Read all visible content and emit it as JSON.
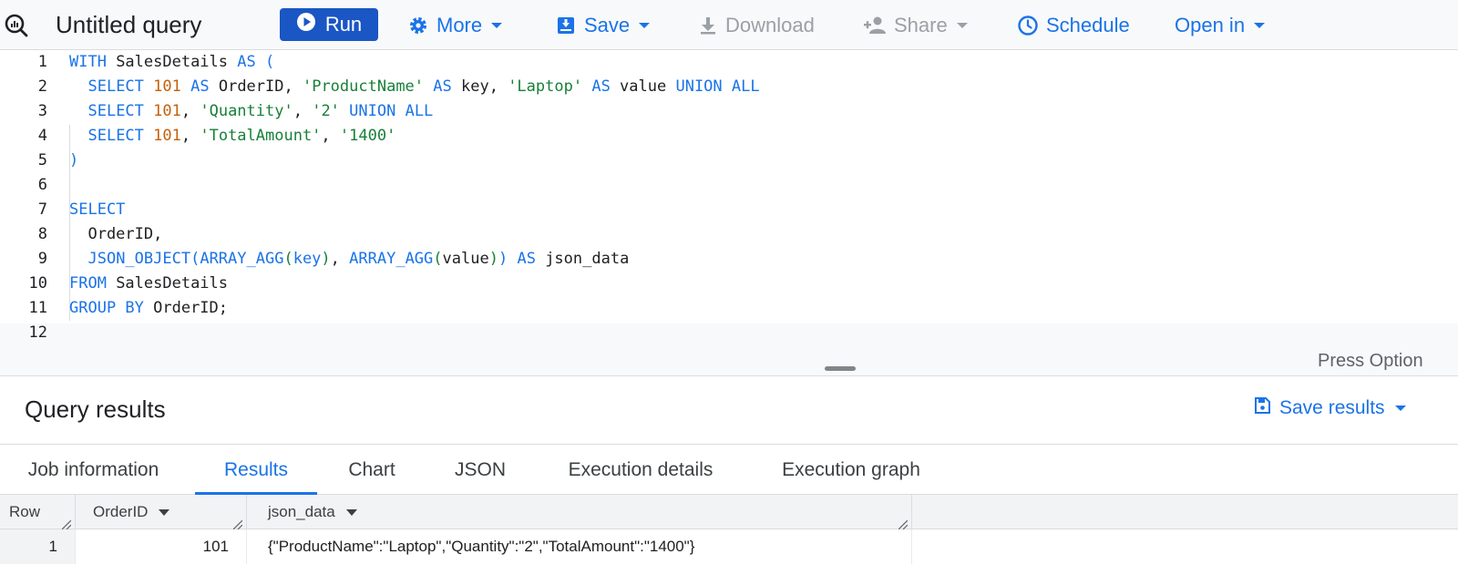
{
  "toolbar": {
    "title": "Untitled query",
    "run_label": "Run",
    "more_label": "More",
    "save_label": "Save",
    "download_label": "Download",
    "share_label": "Share",
    "schedule_label": "Schedule",
    "open_in_label": "Open in"
  },
  "editor": {
    "line_numbers": [
      "1",
      "2",
      "3",
      "4",
      "5",
      "6",
      "7",
      "8",
      "9",
      "10",
      "11",
      "12"
    ],
    "hint": "Press Option"
  },
  "results": {
    "title": "Query results",
    "save_results_label": "Save results",
    "tabs": [
      "Job information",
      "Results",
      "Chart",
      "JSON",
      "Execution details",
      "Execution graph"
    ],
    "active_tab": "Results",
    "columns": [
      "Row",
      "OrderID",
      "json_data"
    ],
    "rows": [
      {
        "row": "1",
        "order_id": "101",
        "json_data": "{\"ProductName\":\"Laptop\",\"Quantity\":\"2\",\"TotalAmount\":\"1400\"}"
      }
    ]
  },
  "colors": {
    "accent": "#1a73e8",
    "run_button": "#1a56c4",
    "keyword": "#1a73e8",
    "number": "#c5600a",
    "string": "#188038"
  },
  "icons": {
    "logo": "query-magnifier-icon",
    "run": "play-circle-icon",
    "more": "gear-icon",
    "save": "save-download-icon",
    "download": "download-icon",
    "share": "person-add-icon",
    "schedule": "clock-icon",
    "save_results": "floppy-icon"
  }
}
